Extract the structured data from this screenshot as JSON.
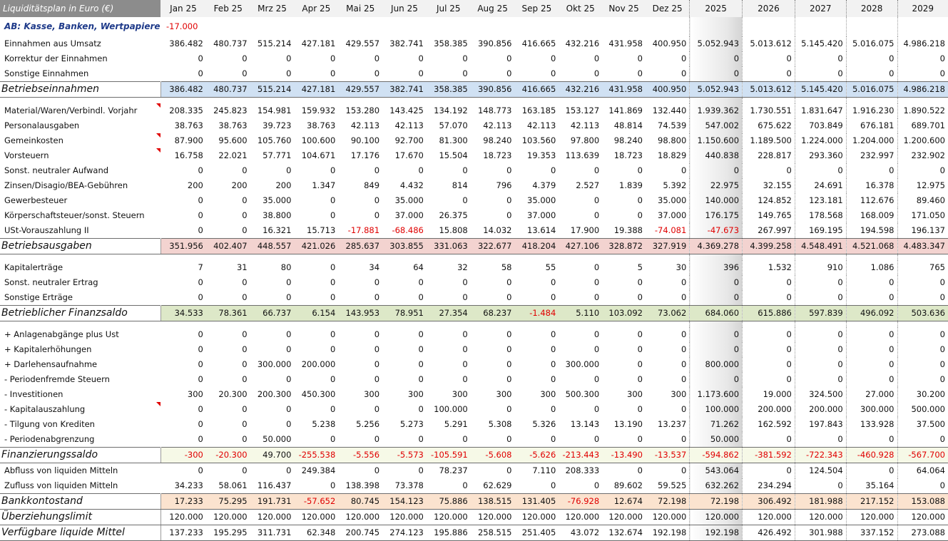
{
  "header": {
    "corner": "Liquiditätsplan in Euro (€)",
    "columns": [
      "Jan 25",
      "Feb 25",
      "Mrz 25",
      "Apr 25",
      "Mai 25",
      "Jun 25",
      "Jul 25",
      "Aug 25",
      "Sep 25",
      "Okt 25",
      "Nov 25",
      "Dez 25",
      "2025",
      "2026",
      "2027",
      "2028",
      "2029"
    ]
  },
  "rows": [
    {
      "type": "ab",
      "label": "AB: Kasse, Banken, Wertpapiere",
      "values": [
        "-17.000",
        "",
        "",
        "",
        "",
        "",
        "",
        "",
        "",
        "",
        "",
        "",
        "",
        "",
        "",
        "",
        ""
      ]
    },
    {
      "type": "row",
      "label": "Einnahmen aus Umsatz",
      "values": [
        "386.482",
        "480.737",
        "515.214",
        "427.181",
        "429.557",
        "382.741",
        "358.385",
        "390.856",
        "416.665",
        "432.216",
        "431.958",
        "400.950",
        "5.052.943",
        "5.013.612",
        "5.145.420",
        "5.016.075",
        "4.986.218"
      ]
    },
    {
      "type": "row",
      "label": "Korrektur der Einnahmen",
      "values": [
        "0",
        "0",
        "0",
        "0",
        "0",
        "0",
        "0",
        "0",
        "0",
        "0",
        "0",
        "0",
        "0",
        "0",
        "0",
        "0",
        "0"
      ]
    },
    {
      "type": "row",
      "label": "Sonstige Einnahmen",
      "values": [
        "0",
        "0",
        "0",
        "0",
        "0",
        "0",
        "0",
        "0",
        "0",
        "0",
        "0",
        "0",
        "0",
        "0",
        "0",
        "0",
        "0"
      ]
    },
    {
      "type": "sum",
      "color": "blue",
      "label": "Betriebseinnahmen",
      "values": [
        "386.482",
        "480.737",
        "515.214",
        "427.181",
        "429.557",
        "382.741",
        "358.385",
        "390.856",
        "416.665",
        "432.216",
        "431.958",
        "400.950",
        "5.052.943",
        "5.013.612",
        "5.145.420",
        "5.016.075",
        "4.986.218"
      ]
    },
    {
      "type": "gap"
    },
    {
      "type": "row",
      "flag": true,
      "label": "Material/Waren/Verbindl. Vorjahr",
      "values": [
        "208.335",
        "245.823",
        "154.981",
        "159.932",
        "153.280",
        "143.425",
        "134.192",
        "148.773",
        "163.185",
        "153.127",
        "141.869",
        "132.440",
        "1.939.362",
        "1.730.551",
        "1.831.647",
        "1.916.230",
        "1.890.522"
      ]
    },
    {
      "type": "row",
      "label": "Personalausgaben",
      "values": [
        "38.763",
        "38.763",
        "39.723",
        "38.763",
        "42.113",
        "42.113",
        "57.070",
        "42.113",
        "42.113",
        "42.113",
        "48.814",
        "74.539",
        "547.002",
        "675.622",
        "703.849",
        "676.181",
        "689.701"
      ]
    },
    {
      "type": "row",
      "flag": true,
      "label": "Gemeinkosten",
      "values": [
        "87.900",
        "95.600",
        "105.760",
        "100.600",
        "90.100",
        "92.700",
        "81.300",
        "98.240",
        "103.560",
        "97.800",
        "98.240",
        "98.800",
        "1.150.600",
        "1.189.500",
        "1.224.000",
        "1.204.000",
        "1.200.600"
      ]
    },
    {
      "type": "row",
      "flag": true,
      "label": "Vorsteuern",
      "values": [
        "16.758",
        "22.021",
        "57.771",
        "104.671",
        "17.176",
        "17.670",
        "15.504",
        "18.723",
        "19.353",
        "113.639",
        "18.723",
        "18.829",
        "440.838",
        "228.817",
        "293.360",
        "232.997",
        "232.902"
      ]
    },
    {
      "type": "row",
      "label": "Sonst. neutraler Aufwand",
      "values": [
        "0",
        "0",
        "0",
        "0",
        "0",
        "0",
        "0",
        "0",
        "0",
        "0",
        "0",
        "0",
        "0",
        "0",
        "0",
        "0",
        "0"
      ]
    },
    {
      "type": "row",
      "label": "Zinsen/Disagio/BEA-Gebühren",
      "values": [
        "200",
        "200",
        "200",
        "1.347",
        "849",
        "4.432",
        "814",
        "796",
        "4.379",
        "2.527",
        "1.839",
        "5.392",
        "22.975",
        "32.155",
        "24.691",
        "16.378",
        "12.975"
      ]
    },
    {
      "type": "row",
      "label": "Gewerbesteuer",
      "values": [
        "0",
        "0",
        "35.000",
        "0",
        "0",
        "35.000",
        "0",
        "0",
        "35.000",
        "0",
        "0",
        "35.000",
        "140.000",
        "124.852",
        "123.181",
        "112.676",
        "89.460"
      ]
    },
    {
      "type": "row",
      "label": "Körperschaftsteuer/sonst. Steuern",
      "values": [
        "0",
        "0",
        "38.800",
        "0",
        "0",
        "37.000",
        "26.375",
        "0",
        "37.000",
        "0",
        "0",
        "37.000",
        "176.175",
        "149.765",
        "178.568",
        "168.009",
        "171.050"
      ]
    },
    {
      "type": "row",
      "label": "USt-Vorauszahlung II",
      "values": [
        "0",
        "0",
        "16.321",
        "15.713",
        "-17.881",
        "-68.486",
        "15.808",
        "14.032",
        "13.614",
        "17.900",
        "19.388",
        "-74.081",
        "-47.673",
        "267.997",
        "169.195",
        "194.598",
        "196.137"
      ]
    },
    {
      "type": "sum",
      "color": "pink",
      "label": "Betriebsausgaben",
      "values": [
        "351.956",
        "402.407",
        "448.557",
        "421.026",
        "285.637",
        "303.855",
        "331.063",
        "322.677",
        "418.204",
        "427.106",
        "328.872",
        "327.919",
        "4.369.278",
        "4.399.258",
        "4.548.491",
        "4.521.068",
        "4.483.347"
      ]
    },
    {
      "type": "gap"
    },
    {
      "type": "row",
      "label": "Kapitalerträge",
      "values": [
        "7",
        "31",
        "80",
        "0",
        "34",
        "64",
        "32",
        "58",
        "55",
        "0",
        "5",
        "30",
        "396",
        "1.532",
        "910",
        "1.086",
        "765"
      ]
    },
    {
      "type": "row",
      "label": "Sonst. neutraler Ertrag",
      "values": [
        "0",
        "0",
        "0",
        "0",
        "0",
        "0",
        "0",
        "0",
        "0",
        "0",
        "0",
        "0",
        "0",
        "0",
        "0",
        "0",
        "0"
      ]
    },
    {
      "type": "row",
      "label": "Sonstige Erträge",
      "values": [
        "0",
        "0",
        "0",
        "0",
        "0",
        "0",
        "0",
        "0",
        "0",
        "0",
        "0",
        "0",
        "0",
        "0",
        "0",
        "0",
        "0"
      ]
    },
    {
      "type": "sum",
      "color": "green",
      "label": "Betrieblicher Finanzsaldo",
      "values": [
        "34.533",
        "78.361",
        "66.737",
        "6.154",
        "143.953",
        "78.951",
        "27.354",
        "68.237",
        "-1.484",
        "5.110",
        "103.092",
        "73.062",
        "684.060",
        "615.886",
        "597.839",
        "496.092",
        "503.636"
      ]
    },
    {
      "type": "gap"
    },
    {
      "type": "row",
      "label": "+ Anlagenabgänge plus Ust",
      "values": [
        "0",
        "0",
        "0",
        "0",
        "0",
        "0",
        "0",
        "0",
        "0",
        "0",
        "0",
        "0",
        "0",
        "0",
        "0",
        "0",
        "0"
      ]
    },
    {
      "type": "row",
      "label": "+ Kapitalerhöhungen",
      "values": [
        "0",
        "0",
        "0",
        "0",
        "0",
        "0",
        "0",
        "0",
        "0",
        "0",
        "0",
        "0",
        "0",
        "0",
        "0",
        "0",
        "0"
      ]
    },
    {
      "type": "row",
      "label": "+ Darlehensaufnahme",
      "values": [
        "0",
        "0",
        "300.000",
        "200.000",
        "0",
        "0",
        "0",
        "0",
        "0",
        "300.000",
        "0",
        "0",
        "800.000",
        "0",
        "0",
        "0",
        "0"
      ]
    },
    {
      "type": "row",
      "label": "- Periodenfremde Steuern",
      "values": [
        "0",
        "0",
        "0",
        "0",
        "0",
        "0",
        "0",
        "0",
        "0",
        "0",
        "0",
        "0",
        "0",
        "0",
        "0",
        "0",
        "0"
      ]
    },
    {
      "type": "row",
      "label": "- Investitionen",
      "values": [
        "300",
        "20.300",
        "200.300",
        "450.300",
        "300",
        "300",
        "300",
        "300",
        "300",
        "500.300",
        "300",
        "300",
        "1.173.600",
        "19.000",
        "324.500",
        "27.000",
        "30.200"
      ]
    },
    {
      "type": "row",
      "flag": true,
      "label": "- Kapitalauszahlung",
      "values": [
        "0",
        "0",
        "0",
        "0",
        "0",
        "0",
        "100.000",
        "0",
        "0",
        "0",
        "0",
        "0",
        "100.000",
        "200.000",
        "200.000",
        "300.000",
        "500.000"
      ]
    },
    {
      "type": "row",
      "label": "- Tilgung von Krediten",
      "values": [
        "0",
        "0",
        "0",
        "5.238",
        "5.256",
        "5.273",
        "5.291",
        "5.308",
        "5.326",
        "13.143",
        "13.190",
        "13.237",
        "71.262",
        "162.592",
        "197.843",
        "133.928",
        "37.500"
      ]
    },
    {
      "type": "row",
      "label": "- Periodenabgrenzung",
      "values": [
        "0",
        "0",
        "50.000",
        "0",
        "0",
        "0",
        "0",
        "0",
        "0",
        "0",
        "0",
        "0",
        "50.000",
        "0",
        "0",
        "0",
        "0"
      ]
    },
    {
      "type": "sum",
      "color": "lgreen",
      "label": "Finanzierungssaldo",
      "values": [
        "-300",
        "-20.300",
        "49.700",
        "-255.538",
        "-5.556",
        "-5.573",
        "-105.591",
        "-5.608",
        "-5.626",
        "-213.443",
        "-13.490",
        "-13.537",
        "-594.862",
        "-381.592",
        "-722.343",
        "-460.928",
        "-567.700"
      ]
    },
    {
      "type": "row",
      "label": "Abfluss von liquiden Mitteln",
      "values": [
        "0",
        "0",
        "0",
        "249.384",
        "0",
        "0",
        "78.237",
        "0",
        "7.110",
        "208.333",
        "0",
        "0",
        "543.064",
        "0",
        "124.504",
        "0",
        "64.064"
      ]
    },
    {
      "type": "row",
      "label": "Zufluss von liquiden Mitteln",
      "values": [
        "34.233",
        "58.061",
        "116.437",
        "0",
        "138.398",
        "73.378",
        "0",
        "62.629",
        "0",
        "0",
        "89.602",
        "59.525",
        "632.262",
        "234.294",
        "0",
        "35.164",
        "0"
      ]
    },
    {
      "type": "sum",
      "color": "peach",
      "label": "Bankkontostand",
      "values": [
        "17.233",
        "75.295",
        "191.731",
        "-57.652",
        "80.745",
        "154.123",
        "75.886",
        "138.515",
        "131.405",
        "-76.928",
        "12.674",
        "72.198",
        "72.198",
        "306.492",
        "181.988",
        "217.152",
        "153.088"
      ]
    },
    {
      "type": "row2",
      "label": "Überziehungslimit",
      "values": [
        "120.000",
        "120.000",
        "120.000",
        "120.000",
        "120.000",
        "120.000",
        "120.000",
        "120.000",
        "120.000",
        "120.000",
        "120.000",
        "120.000",
        "120.000",
        "120.000",
        "120.000",
        "120.000",
        "120.000"
      ]
    },
    {
      "type": "bottom",
      "label": "Verfügbare liquide Mittel",
      "values": [
        "137.233",
        "195.295",
        "311.731",
        "62.348",
        "200.745",
        "274.123",
        "195.886",
        "258.515",
        "251.405",
        "43.072",
        "132.674",
        "192.198",
        "192.198",
        "426.492",
        "301.988",
        "337.152",
        "273.088"
      ]
    }
  ],
  "colors": {
    "negative": "#e00000",
    "ab_label": "#1f3b8a",
    "blue": "#d0e1f3",
    "pink": "#f3d3d0",
    "green": "#dde8c8",
    "lgreen": "#f6f9e7",
    "peach": "#fbe3cf",
    "corner": "#8c8c8c"
  }
}
